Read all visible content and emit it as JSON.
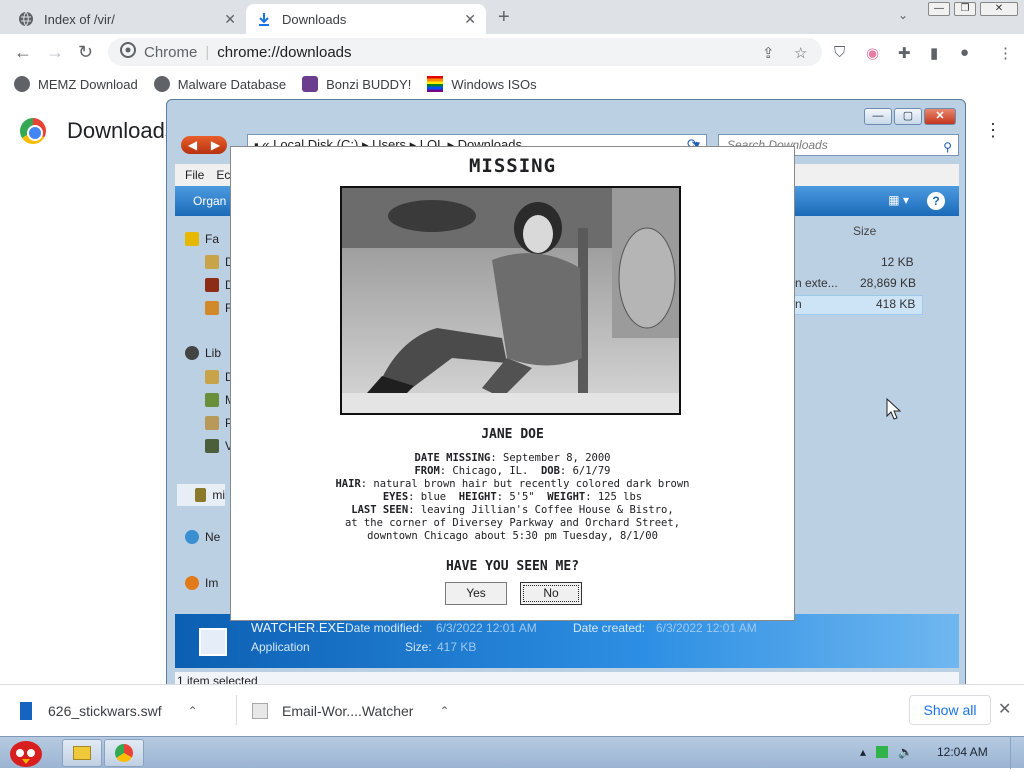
{
  "browser": {
    "tabs": [
      {
        "title": "Index of /vir/",
        "active": false
      },
      {
        "title": "Downloads",
        "active": true
      }
    ],
    "omnibox": {
      "site_label": "Chrome",
      "url": "chrome://downloads"
    },
    "bookmarks": [
      {
        "label": "MEMZ Download",
        "icon": "globe-icon"
      },
      {
        "label": "Malware Database",
        "icon": "globe-icon"
      },
      {
        "label": "Bonzi BUDDY!",
        "icon": "bonzi-icon"
      },
      {
        "label": "Windows ISOs",
        "icon": "windows-flag-icon"
      }
    ],
    "page_title": "Downloads"
  },
  "explorer": {
    "breadcrumb": [
      "Local Disk (C:)",
      "Users",
      "LOL",
      "Downloads"
    ],
    "search_placeholder": "Search Downloads",
    "menu": [
      "File",
      "Ec"
    ],
    "command": "Organ",
    "tree": [
      "Fa",
      "D",
      "D",
      "R",
      "Lib",
      "D",
      "M",
      "P",
      "V",
      "mi",
      "Ne",
      "Im"
    ],
    "column_size": "Size",
    "files": [
      {
        "type": "",
        "size": "12 KB"
      },
      {
        "type": "n exte...",
        "size": "28,869 KB"
      },
      {
        "type": "n",
        "size": "418 KB"
      }
    ],
    "details": {
      "name": "WATCHER.EXE",
      "modified_label": "Date modified:",
      "modified": "6/3/2022 12:01 AM",
      "created_label": "Date created:",
      "created": "6/3/2022 12:01 AM",
      "kind": "Application",
      "size_label": "Size:",
      "size": "417 KB"
    },
    "status": "1 item selected"
  },
  "poster": {
    "title": "MISSING",
    "name": "JANE DOE",
    "date_missing_label": "DATE MISSING",
    "date_missing": ": September 8, 2000",
    "from_label": "FROM",
    "from": ": Chicago, IL.",
    "dob_label": "DOB",
    "dob": ": 6/1/79",
    "hair_label": "HAIR",
    "hair": ": natural brown hair but recently colored dark brown",
    "eyes_label": "EYES",
    "eyes": ": blue",
    "height_label": "HEIGHT",
    "height": ": 5'5\"",
    "weight_label": "WEIGHT",
    "weight": ": 125 lbs",
    "last_seen_label": "LAST SEEN",
    "last_seen_1": ": leaving Jillian's Coffee House & Bistro,",
    "last_seen_2": "at the corner of Diversey Parkway and Orchard Street,",
    "last_seen_3": "downtown Chicago about 5:30 pm Tuesday, 8/1/00",
    "question": "HAVE YOU SEEN ME?",
    "yes": "Yes",
    "no": "No"
  },
  "shelf": {
    "items": [
      {
        "name": "626_stickwars.swf"
      },
      {
        "name": "Email-Wor....Watcher"
      }
    ],
    "show_all": "Show all"
  },
  "taskbar": {
    "time": "12:04 AM"
  }
}
